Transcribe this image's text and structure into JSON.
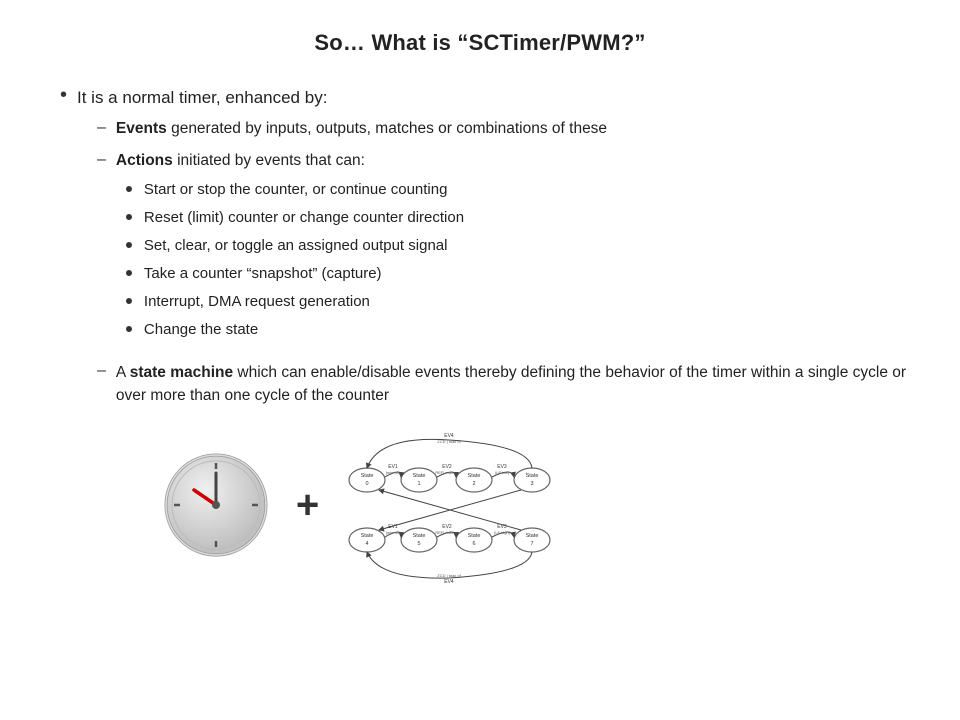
{
  "title": "So… What is  “SCTimer/PWM?”",
  "l1_bullet": "It is a normal timer, enhanced by:",
  "sub_items": [
    {
      "label": "Events",
      "rest": " generated by inputs, outputs, matches or combinations of these",
      "children": []
    },
    {
      "label": "Actions",
      "rest": " initiated by events that can:",
      "children": [
        "Start or stop the counter, or continue counting",
        "Reset (limit) counter or change counter direction",
        "Set, clear, or toggle an assigned output signal",
        "Take a counter “snapshot” (capture)",
        "Interrupt, DMA request generation",
        "Change the state"
      ]
    },
    {
      "label": "A ",
      "label2": "state machine",
      "rest": " which can enable/disable events thereby defining the behavior of the timer within a single cycle or over more than one cycle of the counter",
      "children": [],
      "is_state_machine": true
    }
  ],
  "plus_label": "+",
  "state_labels": [
    "State 0",
    "State 1",
    "State 2",
    "State 3",
    "State 4",
    "State 5",
    "State 6",
    "State 7"
  ],
  "event_labels": [
    "EV1",
    "EV2",
    "EV3",
    "EV4",
    "EV1",
    "EV2",
    "EV3",
    "EV4"
  ],
  "event_notes": [
    "(min off)",
    "REF| max on",
    "(LF low)",
    "ZCD | max of",
    "(min off)",
    "REF| max on",
    "(LF high)",
    "ZCD | max of"
  ]
}
